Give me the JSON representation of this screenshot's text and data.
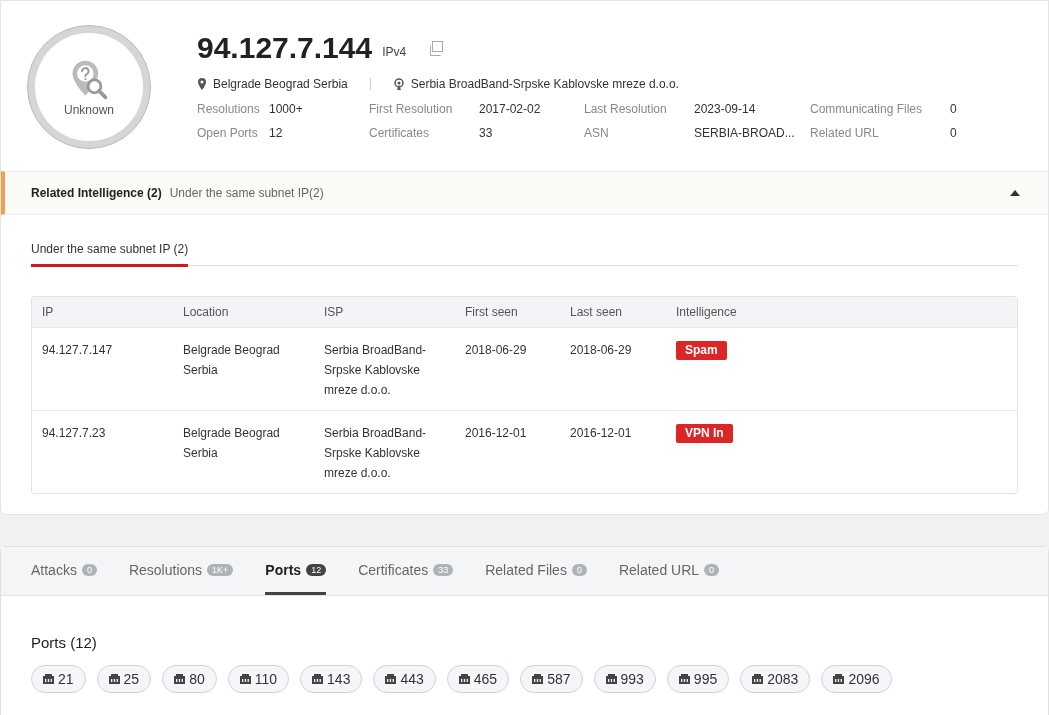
{
  "header": {
    "ip": "94.127.7.144",
    "ip_version": "IPv4",
    "verdict": "Unknown",
    "location": "Belgrade Beograd Serbia",
    "isp": "Serbia BroadBand-Srpske Kablovske mreze d.o.o.",
    "stats": [
      {
        "label": "Resolutions",
        "value": "1000+"
      },
      {
        "label": "First Resolution",
        "value": "2017-02-02"
      },
      {
        "label": "Last Resolution",
        "value": "2023-09-14"
      },
      {
        "label": "Communicating Files",
        "value": "0"
      },
      {
        "label": "Open Ports",
        "value": "12"
      },
      {
        "label": "Certificates",
        "value": "33"
      },
      {
        "label": "ASN",
        "value": "SERBIA-BROAD..."
      },
      {
        "label": "Related URL",
        "value": "0"
      }
    ]
  },
  "related": {
    "title": "Related Intelligence",
    "count": "(2)",
    "summary": "Under the same subnet IP(2)",
    "expanded": true,
    "subtabs": [
      {
        "label": "Under the same subnet IP (2)",
        "selected": true
      }
    ],
    "table": {
      "columns": [
        "IP",
        "Location",
        "ISP",
        "First seen",
        "Last seen",
        "Intelligence"
      ],
      "rows": [
        {
          "ip": "94.127.7.147",
          "location": "Belgrade Beograd Serbia",
          "isp": "Serbia BroadBand-Srpske Kablovske mreze d.o.o.",
          "first_seen": "2018-06-29",
          "last_seen": "2018-06-29",
          "tags": [
            "Spam"
          ]
        },
        {
          "ip": "94.127.7.23",
          "location": "Belgrade Beograd Serbia",
          "isp": "Serbia BroadBand-Srpske Kablovske mreze d.o.o.",
          "first_seen": "2016-12-01",
          "last_seen": "2016-12-01",
          "tags": [
            "VPN In"
          ]
        }
      ]
    }
  },
  "tabs": [
    {
      "label": "Attacks",
      "count": "0",
      "selected": false
    },
    {
      "label": "Resolutions",
      "count": "1K+",
      "selected": false
    },
    {
      "label": "Ports",
      "count": "12",
      "selected": true
    },
    {
      "label": "Certificates",
      "count": "33",
      "selected": false
    },
    {
      "label": "Related Files",
      "count": "0",
      "selected": false
    },
    {
      "label": "Related URL",
      "count": "0",
      "selected": false
    }
  ],
  "ports": {
    "title": "Ports (12)",
    "items": [
      "21",
      "25",
      "80",
      "110",
      "143",
      "443",
      "465",
      "587",
      "993",
      "995",
      "2083",
      "2096"
    ]
  }
}
